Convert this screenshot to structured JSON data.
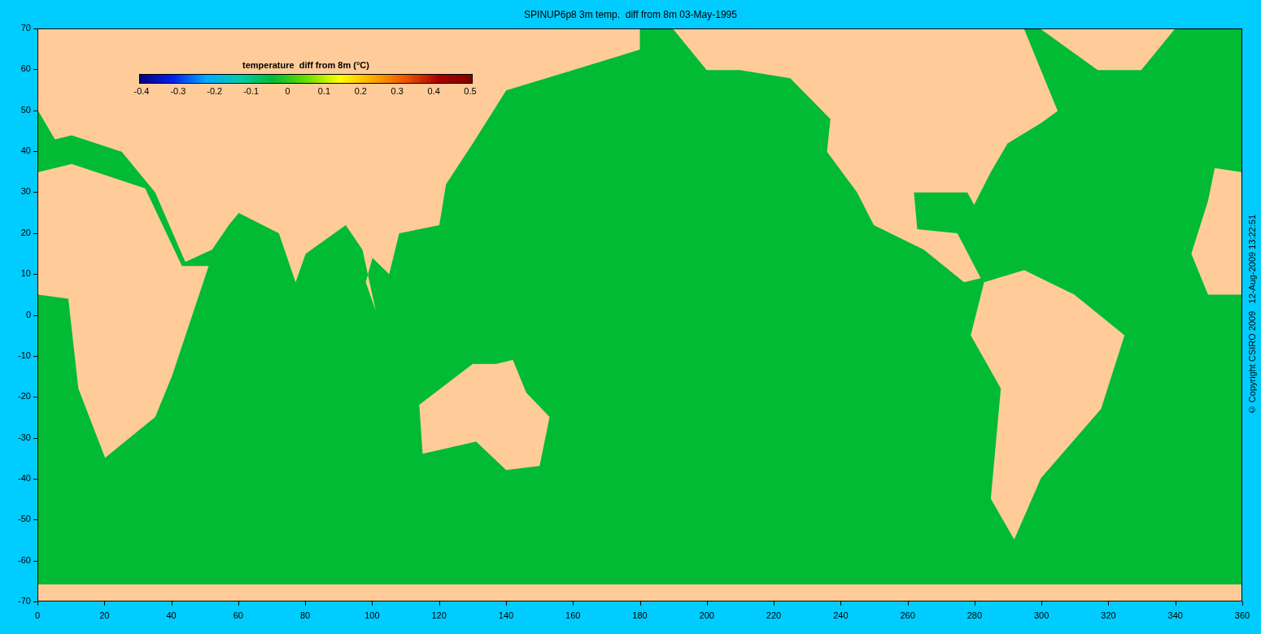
{
  "title": "SPINUP6p8 3m temp.  diff from 8m 03-May-1995",
  "colorbar": {
    "title": "temperature  diff from 8m (°C)",
    "ticks": [
      "-0.4",
      "-0.3",
      "-0.2",
      "-0.1",
      "0",
      "0.1",
      "0.2",
      "0.3",
      "0.4",
      "0.5"
    ]
  },
  "y_axis": {
    "ticks": [
      "70",
      "60",
      "50",
      "40",
      "30",
      "20",
      "10",
      "0",
      "-10",
      "-20",
      "-30",
      "-40",
      "-50",
      "-60",
      "-70"
    ]
  },
  "x_axis": {
    "ticks": [
      "0",
      "20",
      "40",
      "60",
      "80",
      "100",
      "120",
      "140",
      "160",
      "180",
      "200",
      "220",
      "240",
      "260",
      "280",
      "300",
      "320",
      "340",
      "360"
    ]
  },
  "copyright": "© Copyright CSIRO 2009   12-Aug-2009 13:22:51"
}
